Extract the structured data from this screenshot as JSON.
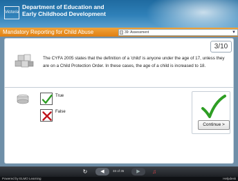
{
  "header": {
    "logo_text": "Victoria",
    "department_line1": "Department of Education and",
    "department_line2": "Early Childhood Development"
  },
  "titlebar": {
    "course_title": "Mandatory Reporting for Child Abuse",
    "section_select_value": "39: Assessment"
  },
  "question": {
    "counter": "3/10",
    "text": "The CYFA 2005 states that the definition of a 'child' is anyone under the age of 17, unless they are on a Child Protection Order. In these cases, the age of a child is increased to 18.",
    "options": [
      {
        "label": "True",
        "state": "correct"
      },
      {
        "label": "False",
        "state": "incorrect"
      }
    ]
  },
  "feedback": {
    "continue_label": "Continue >"
  },
  "navigation": {
    "page_indicator": "33 of 35"
  },
  "footer": {
    "powered_by": "Powered by ELMO Learning",
    "helpdesk": "Helpdesk"
  },
  "colors": {
    "header_blue": "#2f80b8",
    "title_orange": "#e8901f",
    "check_green": "#2e9e24",
    "cross_red": "#c0141b"
  }
}
